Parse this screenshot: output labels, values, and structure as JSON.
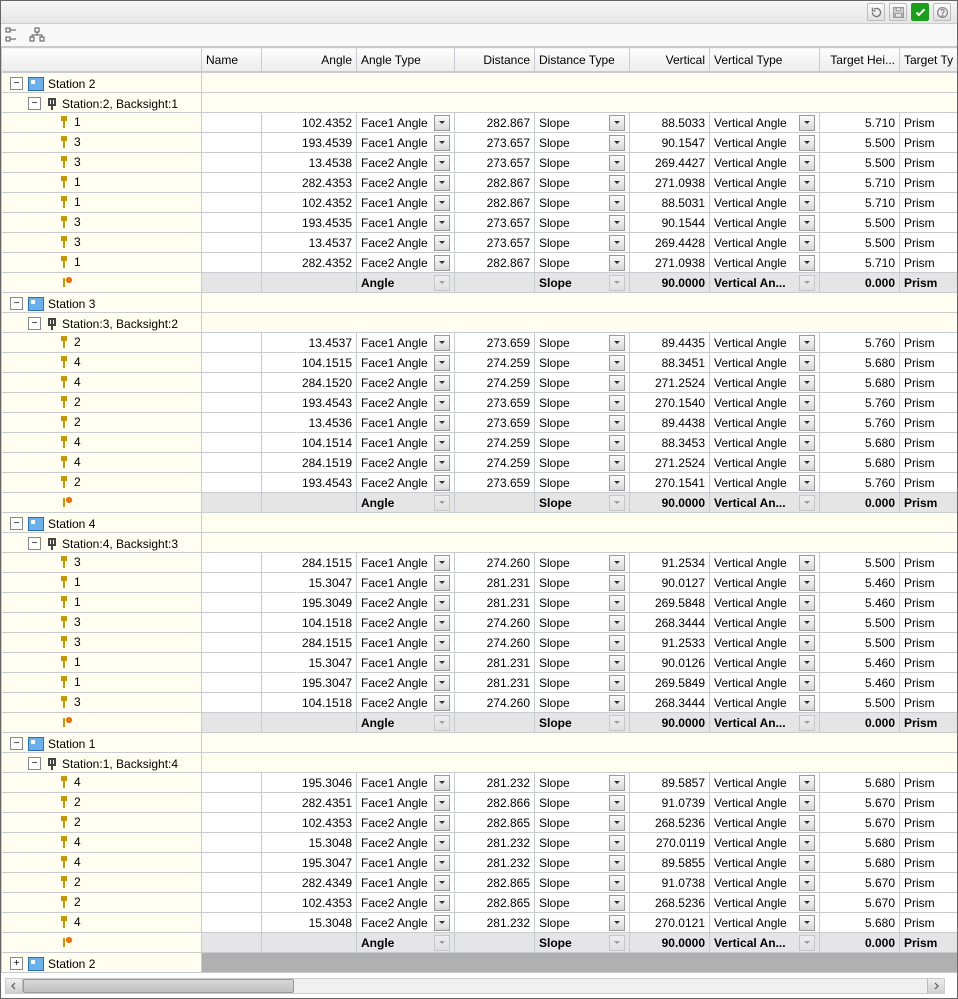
{
  "headers": {
    "tree": "",
    "name": "Name",
    "angle": "Angle",
    "angleType": "Angle Type",
    "distance": "Distance",
    "distanceType": "Distance Type",
    "vertical": "Vertical",
    "verticalType": "Vertical Type",
    "targetHei": "Target Hei...",
    "targetTy": "Target Ty"
  },
  "twistMinus": "−",
  "twistPlus": "+",
  "footerStation": "Station 2",
  "stations": [
    {
      "label": "Station 2",
      "bs": "Station:2, Backsight:1",
      "rows": [
        {
          "n": "1",
          "a": "102.4352",
          "at": "Face1 Angle",
          "d": "282.867",
          "dt": "Slope",
          "v": "88.5033",
          "vt": "Vertical Angle",
          "th": "5.710",
          "tt": "Prism"
        },
        {
          "n": "3",
          "a": "193.4539",
          "at": "Face1 Angle",
          "d": "273.657",
          "dt": "Slope",
          "v": "90.1547",
          "vt": "Vertical Angle",
          "th": "5.500",
          "tt": "Prism"
        },
        {
          "n": "3",
          "a": "13.4538",
          "at": "Face2 Angle",
          "d": "273.657",
          "dt": "Slope",
          "v": "269.4427",
          "vt": "Vertical Angle",
          "th": "5.500",
          "tt": "Prism"
        },
        {
          "n": "1",
          "a": "282.4353",
          "at": "Face2 Angle",
          "d": "282.867",
          "dt": "Slope",
          "v": "271.0938",
          "vt": "Vertical Angle",
          "th": "5.710",
          "tt": "Prism"
        },
        {
          "n": "1",
          "a": "102.4352",
          "at": "Face1 Angle",
          "d": "282.867",
          "dt": "Slope",
          "v": "88.5031",
          "vt": "Vertical Angle",
          "th": "5.710",
          "tt": "Prism"
        },
        {
          "n": "3",
          "a": "193.4535",
          "at": "Face1 Angle",
          "d": "273.657",
          "dt": "Slope",
          "v": "90.1544",
          "vt": "Vertical Angle",
          "th": "5.500",
          "tt": "Prism"
        },
        {
          "n": "3",
          "a": "13.4537",
          "at": "Face2 Angle",
          "d": "273.657",
          "dt": "Slope",
          "v": "269.4428",
          "vt": "Vertical Angle",
          "th": "5.500",
          "tt": "Prism"
        },
        {
          "n": "1",
          "a": "282.4352",
          "at": "Face2 Angle",
          "d": "282.867",
          "dt": "Slope",
          "v": "271.0938",
          "vt": "Vertical Angle",
          "th": "5.710",
          "tt": "Prism"
        }
      ],
      "sum": {
        "at": "Angle",
        "dt": "Slope",
        "v": "90.0000",
        "vt": "Vertical An...",
        "th": "0.000",
        "tt": "Prism"
      }
    },
    {
      "label": "Station 3",
      "bs": "Station:3, Backsight:2",
      "rows": [
        {
          "n": "2",
          "a": "13.4537",
          "at": "Face1 Angle",
          "d": "273.659",
          "dt": "Slope",
          "v": "89.4435",
          "vt": "Vertical Angle",
          "th": "5.760",
          "tt": "Prism"
        },
        {
          "n": "4",
          "a": "104.1515",
          "at": "Face1 Angle",
          "d": "274.259",
          "dt": "Slope",
          "v": "88.3451",
          "vt": "Vertical Angle",
          "th": "5.680",
          "tt": "Prism"
        },
        {
          "n": "4",
          "a": "284.1520",
          "at": "Face2 Angle",
          "d": "274.259",
          "dt": "Slope",
          "v": "271.2524",
          "vt": "Vertical Angle",
          "th": "5.680",
          "tt": "Prism"
        },
        {
          "n": "2",
          "a": "193.4543",
          "at": "Face2 Angle",
          "d": "273.659",
          "dt": "Slope",
          "v": "270.1540",
          "vt": "Vertical Angle",
          "th": "5.760",
          "tt": "Prism"
        },
        {
          "n": "2",
          "a": "13.4536",
          "at": "Face1 Angle",
          "d": "273.659",
          "dt": "Slope",
          "v": "89.4438",
          "vt": "Vertical Angle",
          "th": "5.760",
          "tt": "Prism"
        },
        {
          "n": "4",
          "a": "104.1514",
          "at": "Face1 Angle",
          "d": "274.259",
          "dt": "Slope",
          "v": "88.3453",
          "vt": "Vertical Angle",
          "th": "5.680",
          "tt": "Prism"
        },
        {
          "n": "4",
          "a": "284.1519",
          "at": "Face2 Angle",
          "d": "274.259",
          "dt": "Slope",
          "v": "271.2524",
          "vt": "Vertical Angle",
          "th": "5.680",
          "tt": "Prism"
        },
        {
          "n": "2",
          "a": "193.4543",
          "at": "Face2 Angle",
          "d": "273.659",
          "dt": "Slope",
          "v": "270.1541",
          "vt": "Vertical Angle",
          "th": "5.760",
          "tt": "Prism"
        }
      ],
      "sum": {
        "at": "Angle",
        "dt": "Slope",
        "v": "90.0000",
        "vt": "Vertical An...",
        "th": "0.000",
        "tt": "Prism"
      }
    },
    {
      "label": "Station 4",
      "bs": "Station:4, Backsight:3",
      "rows": [
        {
          "n": "3",
          "a": "284.1515",
          "at": "Face1 Angle",
          "d": "274.260",
          "dt": "Slope",
          "v": "91.2534",
          "vt": "Vertical Angle",
          "th": "5.500",
          "tt": "Prism"
        },
        {
          "n": "1",
          "a": "15.3047",
          "at": "Face1 Angle",
          "d": "281.231",
          "dt": "Slope",
          "v": "90.0127",
          "vt": "Vertical Angle",
          "th": "5.460",
          "tt": "Prism"
        },
        {
          "n": "1",
          "a": "195.3049",
          "at": "Face2 Angle",
          "d": "281.231",
          "dt": "Slope",
          "v": "269.5848",
          "vt": "Vertical Angle",
          "th": "5.460",
          "tt": "Prism"
        },
        {
          "n": "3",
          "a": "104.1518",
          "at": "Face2 Angle",
          "d": "274.260",
          "dt": "Slope",
          "v": "268.3444",
          "vt": "Vertical Angle",
          "th": "5.500",
          "tt": "Prism"
        },
        {
          "n": "3",
          "a": "284.1515",
          "at": "Face1 Angle",
          "d": "274.260",
          "dt": "Slope",
          "v": "91.2533",
          "vt": "Vertical Angle",
          "th": "5.500",
          "tt": "Prism"
        },
        {
          "n": "1",
          "a": "15.3047",
          "at": "Face1 Angle",
          "d": "281.231",
          "dt": "Slope",
          "v": "90.0126",
          "vt": "Vertical Angle",
          "th": "5.460",
          "tt": "Prism"
        },
        {
          "n": "1",
          "a": "195.3047",
          "at": "Face2 Angle",
          "d": "281.231",
          "dt": "Slope",
          "v": "269.5849",
          "vt": "Vertical Angle",
          "th": "5.460",
          "tt": "Prism"
        },
        {
          "n": "3",
          "a": "104.1518",
          "at": "Face2 Angle",
          "d": "274.260",
          "dt": "Slope",
          "v": "268.3444",
          "vt": "Vertical Angle",
          "th": "5.500",
          "tt": "Prism"
        }
      ],
      "sum": {
        "at": "Angle",
        "dt": "Slope",
        "v": "90.0000",
        "vt": "Vertical An...",
        "th": "0.000",
        "tt": "Prism"
      }
    },
    {
      "label": "Station 1",
      "bs": "Station:1, Backsight:4",
      "rows": [
        {
          "n": "4",
          "a": "195.3046",
          "at": "Face1 Angle",
          "d": "281.232",
          "dt": "Slope",
          "v": "89.5857",
          "vt": "Vertical Angle",
          "th": "5.680",
          "tt": "Prism"
        },
        {
          "n": "2",
          "a": "282.4351",
          "at": "Face1 Angle",
          "d": "282.866",
          "dt": "Slope",
          "v": "91.0739",
          "vt": "Vertical Angle",
          "th": "5.670",
          "tt": "Prism"
        },
        {
          "n": "2",
          "a": "102.4353",
          "at": "Face2 Angle",
          "d": "282.865",
          "dt": "Slope",
          "v": "268.5236",
          "vt": "Vertical Angle",
          "th": "5.670",
          "tt": "Prism"
        },
        {
          "n": "4",
          "a": "15.3048",
          "at": "Face2 Angle",
          "d": "281.232",
          "dt": "Slope",
          "v": "270.0119",
          "vt": "Vertical Angle",
          "th": "5.680",
          "tt": "Prism"
        },
        {
          "n": "4",
          "a": "195.3047",
          "at": "Face1 Angle",
          "d": "281.232",
          "dt": "Slope",
          "v": "89.5855",
          "vt": "Vertical Angle",
          "th": "5.680",
          "tt": "Prism"
        },
        {
          "n": "2",
          "a": "282.4349",
          "at": "Face1 Angle",
          "d": "282.865",
          "dt": "Slope",
          "v": "91.0738",
          "vt": "Vertical Angle",
          "th": "5.670",
          "tt": "Prism"
        },
        {
          "n": "2",
          "a": "102.4353",
          "at": "Face2 Angle",
          "d": "282.865",
          "dt": "Slope",
          "v": "268.5236",
          "vt": "Vertical Angle",
          "th": "5.670",
          "tt": "Prism"
        },
        {
          "n": "4",
          "a": "15.3048",
          "at": "Face2 Angle",
          "d": "281.232",
          "dt": "Slope",
          "v": "270.0121",
          "vt": "Vertical Angle",
          "th": "5.680",
          "tt": "Prism"
        }
      ],
      "sum": {
        "at": "Angle",
        "dt": "Slope",
        "v": "90.0000",
        "vt": "Vertical An...",
        "th": "0.000",
        "tt": "Prism"
      }
    }
  ]
}
